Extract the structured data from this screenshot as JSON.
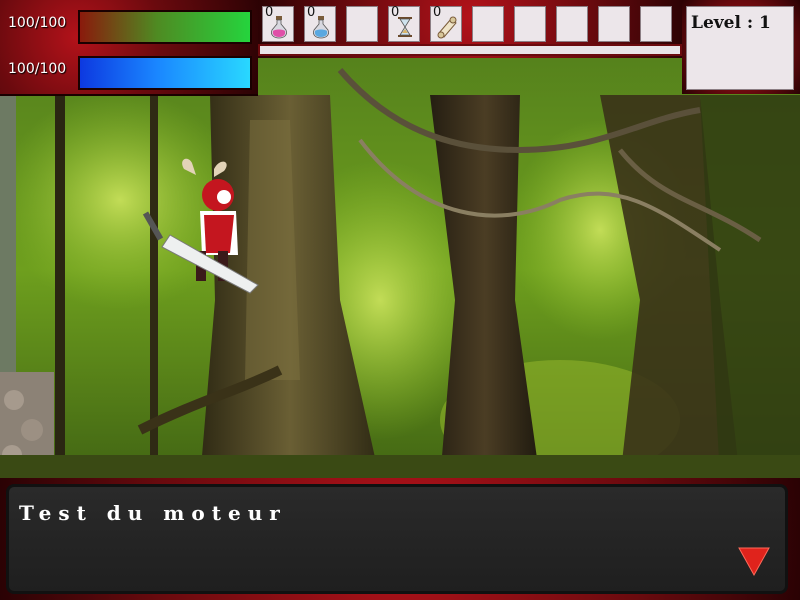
{
  "hud": {
    "hp_text": "100/100",
    "hp_value": 100,
    "hp_max": 100,
    "mp_text": "100/100",
    "mp_value": 100,
    "mp_max": 100
  },
  "inventory": {
    "slots": [
      {
        "count": "0",
        "icon": "pink-potion-icon"
      },
      {
        "count": "0",
        "icon": "blue-potion-icon"
      },
      {
        "count": "",
        "icon": ""
      },
      {
        "count": "0",
        "icon": "hourglass-icon"
      },
      {
        "count": "0",
        "icon": "scroll-icon"
      },
      {
        "count": "",
        "icon": ""
      },
      {
        "count": "",
        "icon": ""
      },
      {
        "count": "",
        "icon": ""
      },
      {
        "count": "",
        "icon": ""
      },
      {
        "count": "",
        "icon": ""
      }
    ]
  },
  "level": {
    "label": "Level : 1"
  },
  "dialog": {
    "text": "Test du moteur",
    "next_icon": "triangle-down-icon"
  },
  "colors": {
    "frame_red": "#b3121a",
    "hp_green": "#25d43d",
    "mp_blue": "#1a86ff"
  }
}
